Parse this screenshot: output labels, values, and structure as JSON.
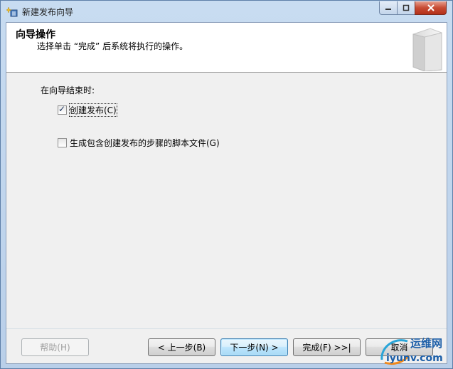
{
  "window": {
    "title": "新建发布向导"
  },
  "header": {
    "title": "向导操作",
    "subtitle": "选择单击 “完成” 后系统将执行的操作。"
  },
  "group": {
    "label": "在向导结束时:"
  },
  "options": [
    {
      "label": "创建发布(C)",
      "checked": true
    },
    {
      "label": "生成包含创建发布的步骤的脚本文件(G)",
      "checked": false
    }
  ],
  "buttons": {
    "help": "帮助(H)",
    "back": "< 上一步(B)",
    "next": "下一步(N) >",
    "finish": "完成(F) >>|",
    "cancel": "取消"
  },
  "watermark": {
    "line1": "运维网",
    "line2": "iyunv.com"
  },
  "colors": {
    "titlebar": "#c8dcf1",
    "close": "#c74b33",
    "watermark": "#1d5fa8"
  }
}
